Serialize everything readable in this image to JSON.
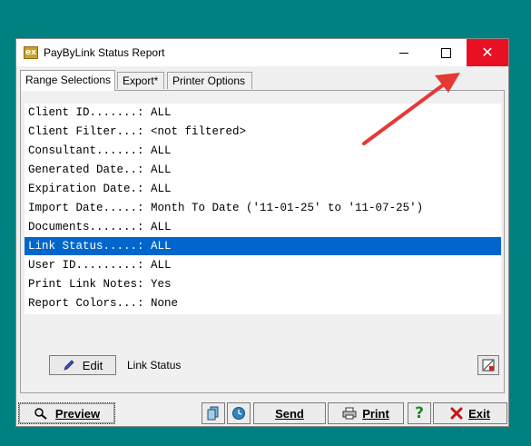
{
  "window": {
    "title": "PayByLink Status Report",
    "icon_text": "ex",
    "controls": [
      "minimize-icon",
      "maximize-icon",
      "close-icon"
    ],
    "close_glyph": "✕"
  },
  "tabs": [
    {
      "label": "Range Selections",
      "active": true
    },
    {
      "label": "Export*",
      "active": false
    },
    {
      "label": "Printer Options",
      "active": false
    }
  ],
  "range_list": [
    {
      "text": "Client ID.......: ALL",
      "selected": false
    },
    {
      "text": "Client Filter...: <not filtered>",
      "selected": false
    },
    {
      "text": "Consultant......: ALL",
      "selected": false
    },
    {
      "text": "Generated Date..: ALL",
      "selected": false
    },
    {
      "text": "Expiration Date.: ALL",
      "selected": false
    },
    {
      "text": "Import Date.....: Month To Date ('11-01-25' to '11-07-25')",
      "selected": false
    },
    {
      "text": "Documents.......: ALL",
      "selected": false
    },
    {
      "text": "Link Status.....: ALL",
      "selected": true
    },
    {
      "text": "User ID.........: ALL",
      "selected": false
    },
    {
      "text": "Print Link Notes: Yes",
      "selected": false
    },
    {
      "text": "Report Colors...: None",
      "selected": false
    }
  ],
  "edit": {
    "button_label": "Edit",
    "current_item": "Link Status"
  },
  "buttons": {
    "preview": "Preview",
    "send": "Send",
    "print": "Print",
    "exit": "Exit"
  },
  "colors": {
    "desktop": "#008080",
    "selection": "#0066cc",
    "close_button": "#e81123",
    "annotation_arrow": "#e53935"
  }
}
